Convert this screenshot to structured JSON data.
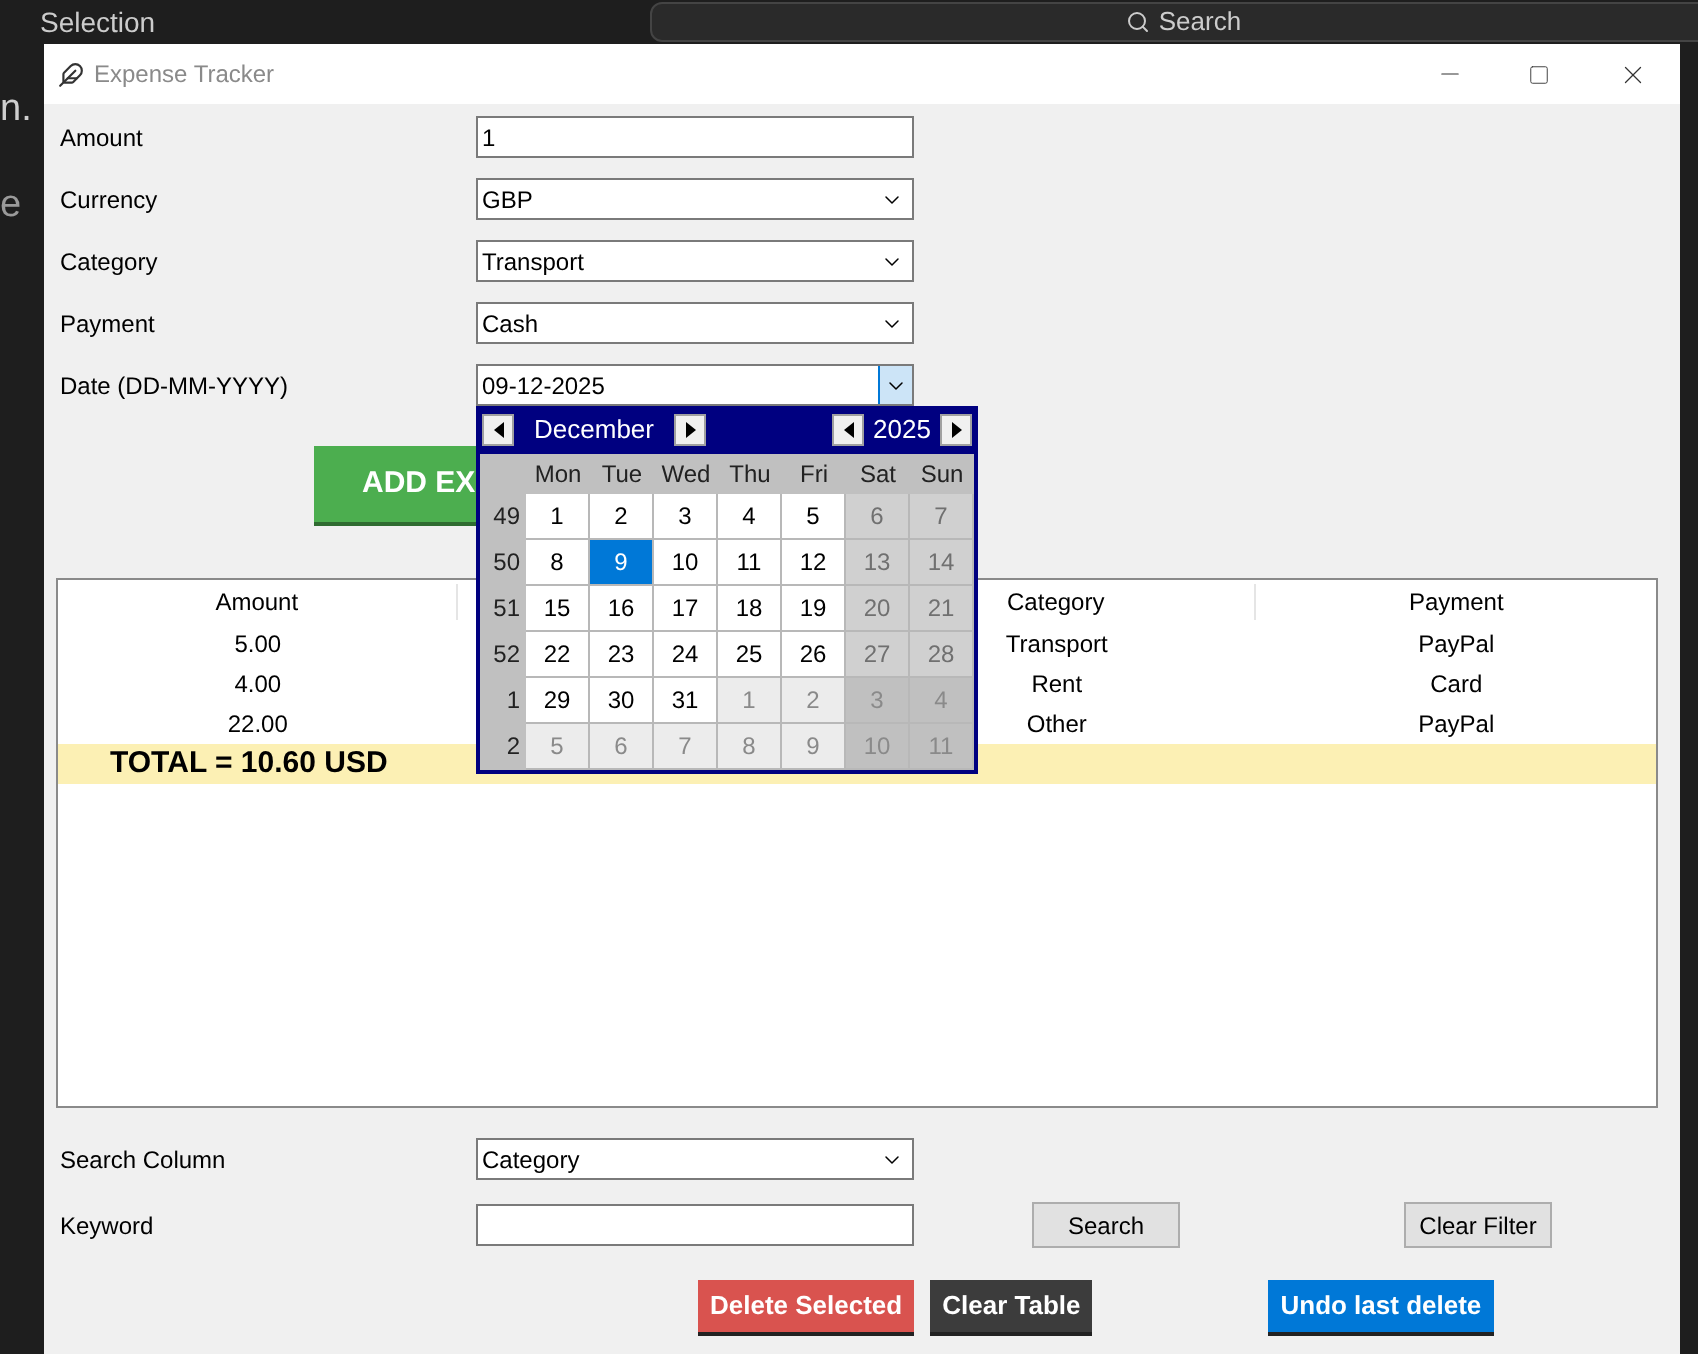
{
  "background": {
    "title": "Selection",
    "search": "Search",
    "side_texts": [
      "n.",
      "e"
    ]
  },
  "window": {
    "title": "Expense Tracker"
  },
  "form": [
    {
      "label": "Amount",
      "kind": "entry",
      "value": "1"
    },
    {
      "label": "Currency",
      "kind": "combo",
      "value": "GBP"
    },
    {
      "label": "Category",
      "kind": "combo",
      "value": "Transport"
    },
    {
      "label": "Payment",
      "kind": "combo",
      "value": "Cash"
    },
    {
      "label": "Date (DD-MM-YYYY)",
      "kind": "date",
      "value": "09-12-2025",
      "calendar_open": true
    }
  ],
  "add_button": "ADD EX",
  "calendar": {
    "month": "December",
    "year": "2025",
    "weekdays": [
      "Mon",
      "Tue",
      "Wed",
      "Thu",
      "Fri",
      "Sat",
      "Sun"
    ],
    "weeks": [
      {
        "number": "49",
        "days": [
          {
            "label": "1",
            "weekend": false,
            "other_month": false,
            "selected": false
          },
          {
            "label": "2",
            "weekend": false,
            "other_month": false,
            "selected": false
          },
          {
            "label": "3",
            "weekend": false,
            "other_month": false,
            "selected": false
          },
          {
            "label": "4",
            "weekend": false,
            "other_month": false,
            "selected": false
          },
          {
            "label": "5",
            "weekend": false,
            "other_month": false,
            "selected": false
          },
          {
            "label": "6",
            "weekend": true,
            "other_month": false,
            "selected": false
          },
          {
            "label": "7",
            "weekend": true,
            "other_month": false,
            "selected": false
          }
        ]
      },
      {
        "number": "50",
        "days": [
          {
            "label": "8",
            "weekend": false,
            "other_month": false,
            "selected": false
          },
          {
            "label": "9",
            "weekend": false,
            "other_month": false,
            "selected": true
          },
          {
            "label": "10",
            "weekend": false,
            "other_month": false,
            "selected": false
          },
          {
            "label": "11",
            "weekend": false,
            "other_month": false,
            "selected": false
          },
          {
            "label": "12",
            "weekend": false,
            "other_month": false,
            "selected": false
          },
          {
            "label": "13",
            "weekend": true,
            "other_month": false,
            "selected": false
          },
          {
            "label": "14",
            "weekend": true,
            "other_month": false,
            "selected": false
          }
        ]
      },
      {
        "number": "51",
        "days": [
          {
            "label": "15",
            "weekend": false,
            "other_month": false,
            "selected": false
          },
          {
            "label": "16",
            "weekend": false,
            "other_month": false,
            "selected": false
          },
          {
            "label": "17",
            "weekend": false,
            "other_month": false,
            "selected": false
          },
          {
            "label": "18",
            "weekend": false,
            "other_month": false,
            "selected": false
          },
          {
            "label": "19",
            "weekend": false,
            "other_month": false,
            "selected": false
          },
          {
            "label": "20",
            "weekend": true,
            "other_month": false,
            "selected": false
          },
          {
            "label": "21",
            "weekend": true,
            "other_month": false,
            "selected": false
          }
        ]
      },
      {
        "number": "52",
        "days": [
          {
            "label": "22",
            "weekend": false,
            "other_month": false,
            "selected": false
          },
          {
            "label": "23",
            "weekend": false,
            "other_month": false,
            "selected": false
          },
          {
            "label": "24",
            "weekend": false,
            "other_month": false,
            "selected": false
          },
          {
            "label": "25",
            "weekend": false,
            "other_month": false,
            "selected": false
          },
          {
            "label": "26",
            "weekend": false,
            "other_month": false,
            "selected": false
          },
          {
            "label": "27",
            "weekend": true,
            "other_month": false,
            "selected": false
          },
          {
            "label": "28",
            "weekend": true,
            "other_month": false,
            "selected": false
          }
        ]
      },
      {
        "number": "1",
        "days": [
          {
            "label": "29",
            "weekend": false,
            "other_month": false,
            "selected": false
          },
          {
            "label": "30",
            "weekend": false,
            "other_month": false,
            "selected": false
          },
          {
            "label": "31",
            "weekend": false,
            "other_month": false,
            "selected": false
          },
          {
            "label": "1",
            "weekend": false,
            "other_month": true,
            "selected": false
          },
          {
            "label": "2",
            "weekend": false,
            "other_month": true,
            "selected": false
          },
          {
            "label": "3",
            "weekend": true,
            "other_month": true,
            "selected": false
          },
          {
            "label": "4",
            "weekend": true,
            "other_month": true,
            "selected": false
          }
        ]
      },
      {
        "number": "2",
        "days": [
          {
            "label": "5",
            "weekend": false,
            "other_month": true,
            "selected": false
          },
          {
            "label": "6",
            "weekend": false,
            "other_month": true,
            "selected": false
          },
          {
            "label": "7",
            "weekend": false,
            "other_month": true,
            "selected": false
          },
          {
            "label": "8",
            "weekend": false,
            "other_month": true,
            "selected": false
          },
          {
            "label": "9",
            "weekend": false,
            "other_month": true,
            "selected": false
          },
          {
            "label": "10",
            "weekend": true,
            "other_month": true,
            "selected": false
          },
          {
            "label": "11",
            "weekend": true,
            "other_month": true,
            "selected": false
          }
        ]
      }
    ]
  },
  "table": {
    "columns": [
      "Amount",
      "Category",
      "Payment"
    ],
    "rows": [
      {
        "amount": "5.00",
        "category": "Transport",
        "payment": "PayPal"
      },
      {
        "amount": "4.00",
        "category": "Rent",
        "payment": "Card"
      },
      {
        "amount": "22.00",
        "category": "Other",
        "payment": "PayPal"
      }
    ],
    "total": "TOTAL = 10.60 USD"
  },
  "search": {
    "column_label": "Search Column",
    "column_value": "Category",
    "keyword_label": "Keyword",
    "search_button": "Search",
    "clear_filter_button": "Clear Filter"
  },
  "actions": [
    {
      "label": "Delete Selected",
      "kind": "danger"
    },
    {
      "label": "Clear Table",
      "kind": "dark"
    },
    {
      "label": "Undo last delete",
      "kind": "primary"
    }
  ]
}
